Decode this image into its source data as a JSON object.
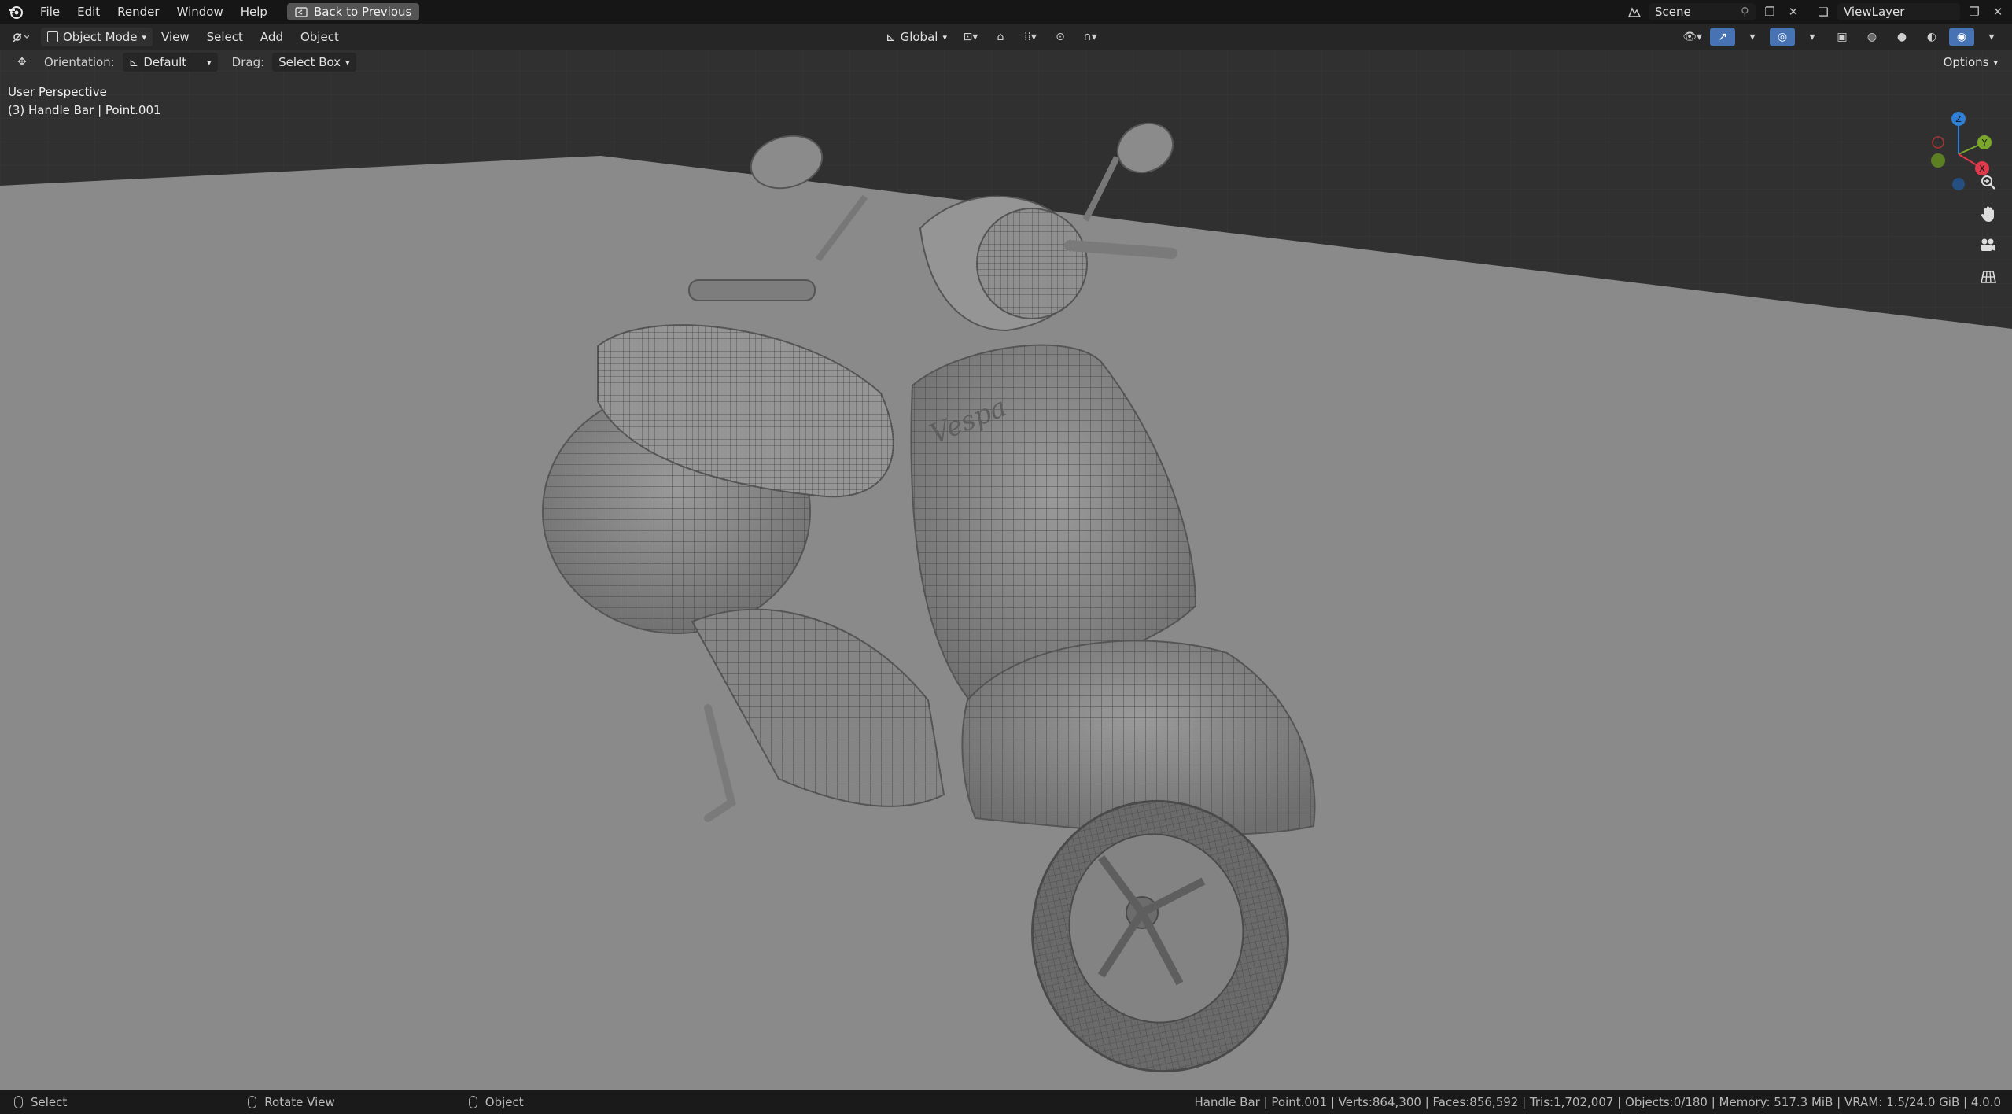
{
  "topbar": {
    "menus": [
      "File",
      "Edit",
      "Render",
      "Window",
      "Help"
    ],
    "back_button": "Back to Previous",
    "scene": "Scene",
    "view_layer": "ViewLayer"
  },
  "header": {
    "mode": "Object Mode",
    "menus": [
      "View",
      "Select",
      "Add",
      "Object"
    ],
    "transform_orientation": "Global"
  },
  "tool_settings": {
    "orientation_label": "Orientation:",
    "orientation_value": "Default",
    "drag_label": "Drag:",
    "drag_value": "Select Box",
    "options": "Options"
  },
  "viewport": {
    "perspective": "User Perspective",
    "active_object": "(3) Handle Bar | Point.001",
    "gizmo_axes": [
      "Z",
      "Y",
      "X"
    ],
    "nav_icons": [
      "zoom-icon",
      "pan-hand-icon",
      "camera-icon",
      "ortho-grid-icon"
    ],
    "model_logo": "Vespa"
  },
  "statusbar": {
    "select": "Select",
    "rotate": "Rotate View",
    "object": "Object",
    "stats": "Handle Bar | Point.001 | Verts:864,300 | Faces:856,592 | Tris:1,702,007 | Objects:0/180 | Memory: 517.3 MiB | VRAM: 1.5/24.0 GiB | 4.0.0"
  },
  "colors": {
    "accent": "#4772b3",
    "axis_x": "#e0394b",
    "axis_y": "#7ba82a",
    "axis_z": "#2f7fd6",
    "floor": "#8a8a8a",
    "background": "#303030"
  }
}
